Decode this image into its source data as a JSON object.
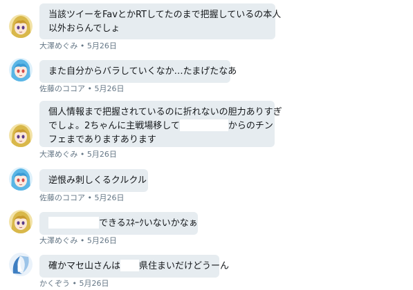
{
  "messages": [
    {
      "avatar": "blonde-anime-girl-avatar",
      "lines": [
        "当該ツイーをFavとかRTしてたのまで把握しているの本人",
        "以外おらんでしょ"
      ],
      "sender": "大澤めぐみ",
      "separator": "•",
      "date": "5月26日"
    },
    {
      "avatar": "blue-hair-anime-girl-avatar",
      "lines": [
        "また自分からバラしていくなか…たまげたなあ"
      ],
      "sender": "佐藤のココア",
      "separator": "•",
      "date": "5月26日"
    },
    {
      "avatar": "blonde-anime-girl-avatar",
      "lines": [
        "個人情報まで把握されているのに折れないの胆力ありすぎ"
      ],
      "line2_before": "でしょ。2ちゃんに主戦場移して",
      "line2_after": "からのチン",
      "line3": "フェまでありますあります",
      "sender": "大澤めぐみ",
      "separator": "•",
      "date": "5月26日"
    },
    {
      "avatar": "blue-hair-anime-girl-avatar",
      "lines": [
        "逆恨み刺しくるクルクル"
      ],
      "sender": "佐藤のココア",
      "separator": "•",
      "date": "5月26日"
    },
    {
      "avatar": "blonde-anime-girl-avatar",
      "text_after": "できるｽﾈｰｸいないかなぁ",
      "sender": "大澤めぐみ",
      "separator": "•",
      "date": "5月26日"
    },
    {
      "avatar": "blue-white-swirl-avatar",
      "text_before": "確かマセ山さんは",
      "text_after": "県住まいだけどうーん",
      "sender": "かくぞう",
      "separator": "•",
      "date": "5月26日"
    }
  ]
}
